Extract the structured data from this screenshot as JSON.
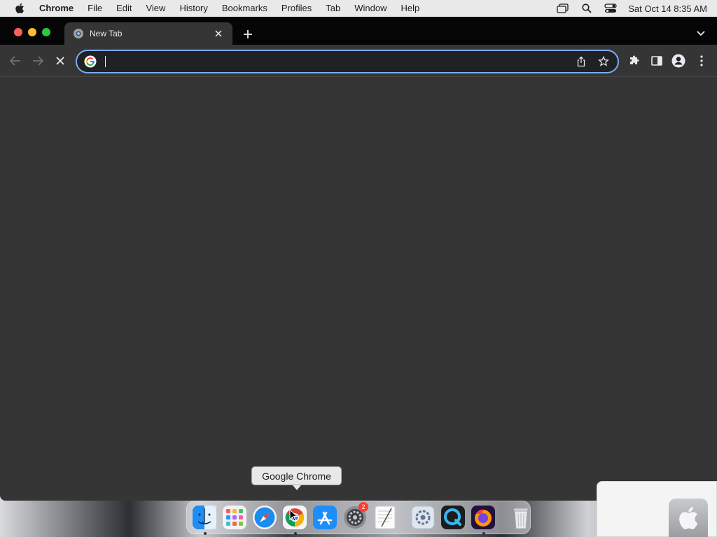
{
  "menubar": {
    "app_name": "Chrome",
    "items": [
      "File",
      "Edit",
      "View",
      "History",
      "Bookmarks",
      "Profiles",
      "Tab",
      "Window",
      "Help"
    ],
    "clock": "Sat Oct 14  8:35 AM",
    "status_icons": [
      "screen-mirroring-icon",
      "spotlight-search-icon",
      "control-center-icon"
    ]
  },
  "browser": {
    "tab": {
      "title": "New Tab",
      "favicon": "chrome-icon"
    },
    "omnibox": {
      "value": "",
      "placeholder": ""
    },
    "accent_color": "#7cacf8",
    "background_color": "#353535"
  },
  "tooltip": {
    "text": "Google Chrome"
  },
  "dock": {
    "items": [
      {
        "name": "Finder",
        "icon": "finder-icon",
        "running": true
      },
      {
        "name": "Launchpad",
        "icon": "launchpad-icon",
        "running": false
      },
      {
        "name": "Safari",
        "icon": "safari-icon",
        "running": false
      },
      {
        "name": "Google Chrome",
        "icon": "chrome-icon",
        "running": true
      },
      {
        "name": "App Store",
        "icon": "app-store-icon",
        "running": false
      },
      {
        "name": "System Preferences",
        "icon": "system-preferences-icon",
        "running": false,
        "badge": "2"
      },
      {
        "name": "TextEdit",
        "icon": "textedit-icon",
        "running": false
      },
      {
        "name": "Directory Utility",
        "icon": "directory-utility-icon",
        "running": false
      },
      {
        "name": "QuickTime Player",
        "icon": "quicktime-icon",
        "running": false
      },
      {
        "name": "Firefox",
        "icon": "firefox-icon",
        "running": true
      },
      {
        "name": "Trash",
        "icon": "trash-icon",
        "running": false
      }
    ]
  }
}
